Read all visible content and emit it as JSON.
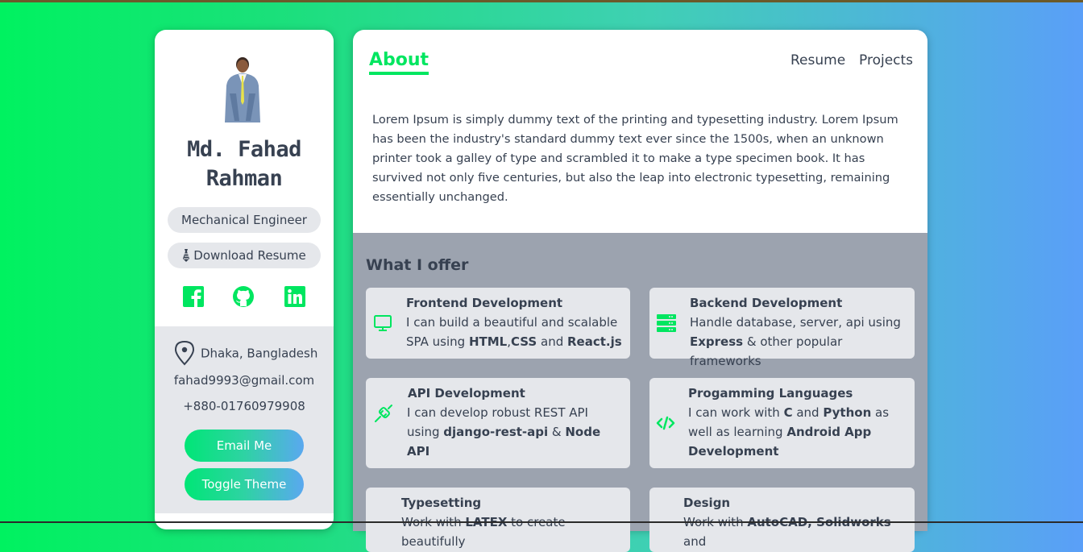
{
  "profile": {
    "name_line1": "Md. Fahad",
    "name_line2": "Rahman",
    "job_title": "Mechanical Engineer",
    "download_label": "Download Resume",
    "location": "Dhaka, Bangladesh",
    "email": "fahad9993@gmail.com",
    "phone": "+880-01760979908",
    "email_button": "Email Me",
    "theme_button": "Toggle Theme"
  },
  "nav": {
    "about": "About",
    "resume": "Resume",
    "projects": "Projects"
  },
  "about_text": "Lorem Ipsum is simply dummy text of the printing and typesetting industry. Lorem Ipsum has been the industry's standard dummy text ever since the 1500s, when an unknown printer took a galley of type and scrambled it to make a type specimen book. It has survived not only five centuries, but also the leap into electronic typesetting, remaining essentially unchanged.",
  "offer": {
    "title": "What I offer",
    "cards": [
      {
        "title": "Frontend Development",
        "desc": [
          "I can build a beautiful and scalable SPA using ",
          "HTML",
          ",",
          "CSS",
          " and ",
          "React.js"
        ],
        "icon": "monitor-icon"
      },
      {
        "title": "Backend Development",
        "desc": [
          "Handle database, server, api using ",
          "Express",
          " & other popular frameworks"
        ],
        "icon": "server-icon"
      },
      {
        "title": "API Development",
        "desc": [
          "I can develop robust REST API using ",
          "django-rest-api",
          " & ",
          "Node API"
        ],
        "icon": "plug-icon"
      },
      {
        "title": "Progamming Languages",
        "desc": [
          "I can work with ",
          "C",
          " and ",
          "Python",
          " as well as learning ",
          "Android App Development"
        ],
        "icon": "code-icon"
      },
      {
        "title": "Typesetting",
        "desc": [
          "Work with ",
          "LATEX",
          " to create beautifully"
        ],
        "icon": ""
      },
      {
        "title": "Design",
        "desc": [
          "Work with ",
          "AutoCAD, Solidworks",
          " and"
        ],
        "icon": ""
      }
    ]
  },
  "colors": {
    "accent": "#00e660",
    "text": "#374151",
    "panel_gray": "#e5e7eb",
    "offer_bg": "#9ca3af"
  }
}
